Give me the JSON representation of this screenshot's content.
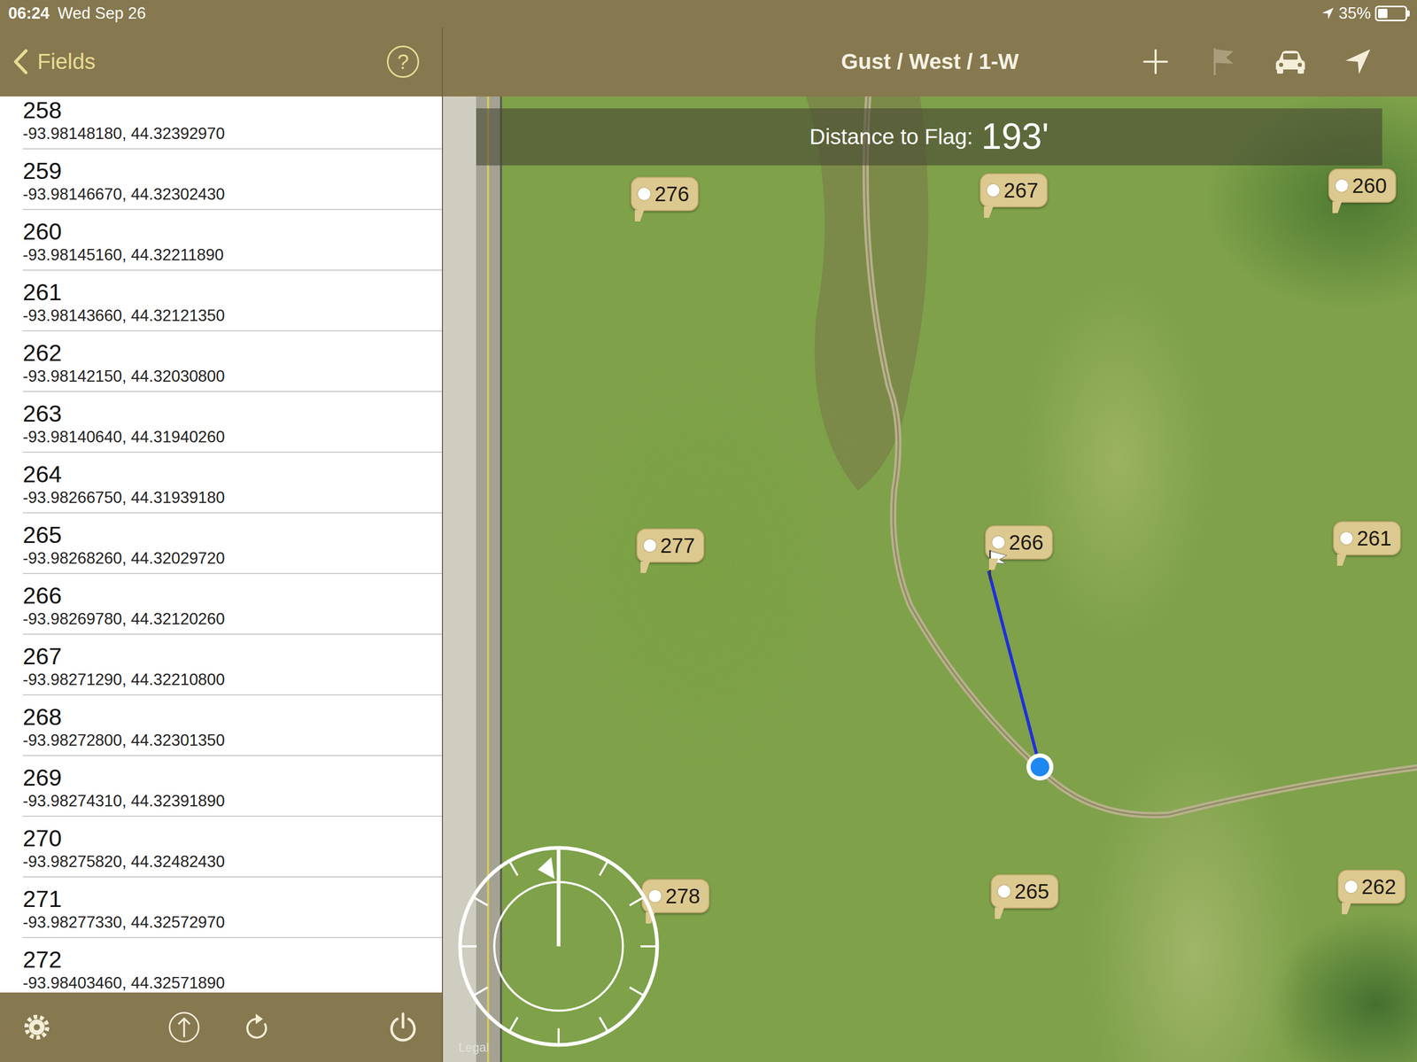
{
  "status_bar": {
    "time": "06:24",
    "date": "Wed Sep 26",
    "battery": "35%",
    "battery_level": 0.35
  },
  "sidebar": {
    "back": "Fields",
    "help": "?",
    "items": [
      {
        "label": "258",
        "coords": "-93.98148180, 44.32392970"
      },
      {
        "label": "259",
        "coords": "-93.98146670, 44.32302430"
      },
      {
        "label": "260",
        "coords": "-93.98145160, 44.32211890"
      },
      {
        "label": "261",
        "coords": "-93.98143660, 44.32121350"
      },
      {
        "label": "262",
        "coords": "-93.98142150, 44.32030800"
      },
      {
        "label": "263",
        "coords": "-93.98140640, 44.31940260"
      },
      {
        "label": "264",
        "coords": "-93.98266750, 44.31939180"
      },
      {
        "label": "265",
        "coords": "-93.98268260, 44.32029720"
      },
      {
        "label": "266",
        "coords": "-93.98269780, 44.32120260"
      },
      {
        "label": "267",
        "coords": "-93.98271290, 44.32210800"
      },
      {
        "label": "268",
        "coords": "-93.98272800, 44.32301350"
      },
      {
        "label": "269",
        "coords": "-93.98274310, 44.32391890"
      },
      {
        "label": "270",
        "coords": "-93.98275820, 44.32482430"
      },
      {
        "label": "271",
        "coords": "-93.98277330, 44.32572970"
      },
      {
        "label": "272",
        "coords": "-93.98403460, 44.32571890"
      }
    ],
    "toolbar": [
      {
        "kind": "settings"
      },
      {
        "kind": "upload"
      },
      {
        "kind": "refresh"
      },
      {
        "kind": "power"
      }
    ]
  },
  "map": {
    "title": "Gust / West / 1-W",
    "actions": [
      {
        "kind": "add",
        "disabled": false
      },
      {
        "kind": "flag",
        "disabled": true
      },
      {
        "kind": "car",
        "disabled": false
      },
      {
        "kind": "locate",
        "disabled": false
      }
    ],
    "distance_label": "Distance to Flag:",
    "distance": "193'",
    "pins": [
      {
        "label": "276",
        "flagged": false
      },
      {
        "label": "267",
        "flagged": false
      },
      {
        "label": "260",
        "flagged": false
      },
      {
        "label": "277",
        "flagged": false
      },
      {
        "label": "266",
        "flagged": true
      },
      {
        "label": "261",
        "flagged": false
      },
      {
        "label": "278",
        "flagged": false
      },
      {
        "label": "265",
        "flagged": false
      },
      {
        "label": "262",
        "flagged": false
      }
    ],
    "legal": "Legal"
  }
}
